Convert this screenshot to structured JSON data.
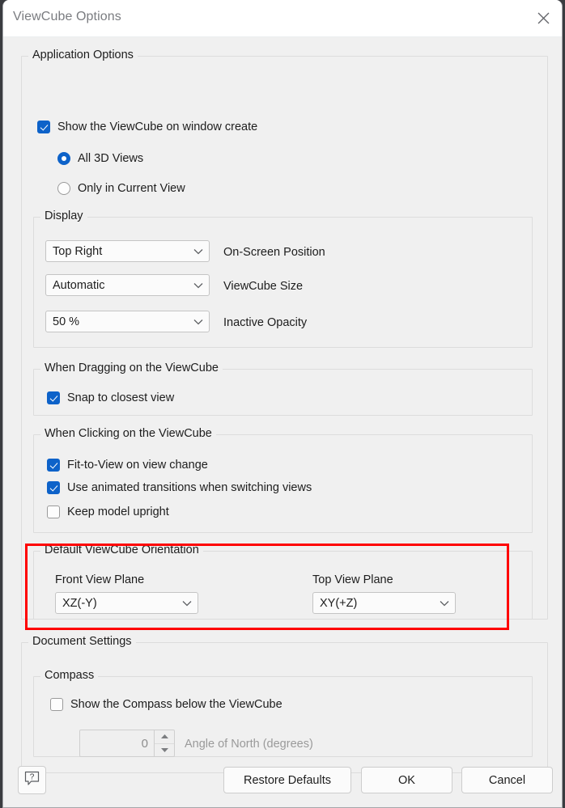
{
  "window": {
    "title": "ViewCube Options",
    "close_icon": "close-icon"
  },
  "application_options": {
    "legend": "Application Options",
    "show_viewcube": {
      "label": "Show the ViewCube on window create",
      "checked": true
    },
    "radios": [
      {
        "label": "All 3D Views",
        "selected": true
      },
      {
        "label": "Only in Current View",
        "selected": false
      }
    ],
    "display": {
      "legend": "Display",
      "fields": [
        {
          "value": "Top Right",
          "label": "On-Screen Position",
          "icon": "chevron-down-icon"
        },
        {
          "value": "Automatic",
          "label": "ViewCube Size",
          "icon": "chevron-down-icon"
        },
        {
          "value": "50 %",
          "label": "Inactive Opacity",
          "icon": "chevron-down-icon"
        }
      ]
    },
    "dragging": {
      "legend": "When Dragging on the ViewCube",
      "items": [
        {
          "label": "Snap to closest view",
          "checked": true
        }
      ]
    },
    "clicking": {
      "legend": "When Clicking on the ViewCube",
      "items": [
        {
          "label": "Fit-to-View on view change",
          "checked": true
        },
        {
          "label": "Use animated transitions when switching views",
          "checked": true
        },
        {
          "label": "Keep model upright",
          "checked": false
        }
      ]
    },
    "orientation": {
      "legend": "Default ViewCube Orientation",
      "highlight_color": "#ff0000",
      "front": {
        "label": "Front View Plane",
        "value": "XZ(-Y)",
        "icon": "chevron-down-icon"
      },
      "top": {
        "label": "Top View Plane",
        "value": "XY(+Z)",
        "icon": "chevron-down-icon"
      }
    }
  },
  "document_settings": {
    "legend": "Document Settings",
    "compass": {
      "legend": "Compass",
      "show": {
        "label": "Show the Compass below the ViewCube",
        "checked": false
      },
      "angle": {
        "value": "0",
        "label": "Angle of North (degrees)",
        "up_icon": "triangle-up-icon",
        "down_icon": "triangle-down-icon",
        "disabled": true
      }
    }
  },
  "footer": {
    "help_icon": "help-question-icon",
    "buttons": [
      {
        "label": "Restore Defaults"
      },
      {
        "label": "OK"
      },
      {
        "label": "Cancel"
      }
    ]
  }
}
